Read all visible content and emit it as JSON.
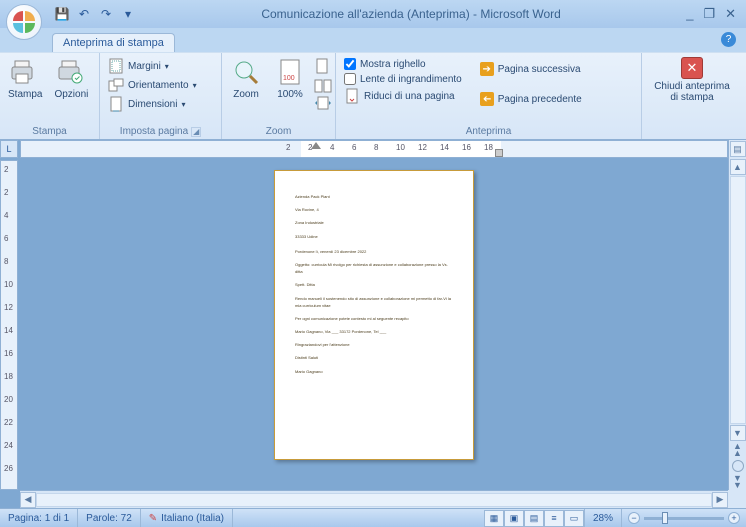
{
  "title": "Comunicazione all'azienda (Anteprima) - Microsoft Word",
  "tab": "Anteprima di stampa",
  "qat": {
    "save": "💾",
    "undo": "↶",
    "redo": "↷",
    "more": "▾"
  },
  "ribbon": {
    "stampa": {
      "print": "Stampa",
      "options": "Opzioni",
      "label": "Stampa"
    },
    "imposta": {
      "margins": "Margini",
      "orientation": "Orientamento",
      "size": "Dimensioni",
      "label": "Imposta pagina"
    },
    "zoom": {
      "zoom": "Zoom",
      "hundred": "100%",
      "label": "Zoom"
    },
    "anteprima": {
      "ruler": "Mostra righello",
      "ruler_checked": true,
      "magnifier": "Lente di ingrandimento",
      "magnifier_checked": false,
      "shrink": "Riduci di una pagina",
      "next": "Pagina successiva",
      "prev": "Pagina precedente",
      "label": "Anteprima"
    },
    "close": {
      "line1": "Chiudi anteprima",
      "line2": "di stampa"
    }
  },
  "ruler_h": [
    "2",
    "2",
    "4",
    "6",
    "8",
    "10",
    "12",
    "14",
    "16",
    "18"
  ],
  "ruler_v": [
    "2",
    "2",
    "4",
    "6",
    "8",
    "10",
    "12",
    "14",
    "16",
    "18",
    "20",
    "22",
    "24",
    "26"
  ],
  "doc": {
    "l1": "Azienda Pack Plant",
    "l2": "Via Rovine, 4",
    "l3": "Zona Industriale",
    "l4": "33333 Udine",
    "l5": "Pordenone lì, venerdì 23 dicembre 2022",
    "l6": "Oggetto: curricula Mi rivolgo per richiesta di assunzione e collaborazione presso la Vs. ditta",
    "l7": "Spett. Ditta",
    "l8": "Rendo manueli il sostenendo sito di assunzione e collaborazione mi permetto di far-Vi la mia curriculum vitae",
    "l9": "Per ogni comunicazione potete contesto mi al seguente recapito",
    "l10": "Mario Gagnano, Via ___ 33172 Pordenone, Tel ___",
    "l11": "Ringraziandovi per l'attenzione",
    "l12": "Distinti Saluti",
    "l13": "Mario Gagnano"
  },
  "status": {
    "page": "Pagina: 1 di 1",
    "words": "Parole: 72",
    "lang": "Italiano (Italia)",
    "zoom": "28%"
  }
}
